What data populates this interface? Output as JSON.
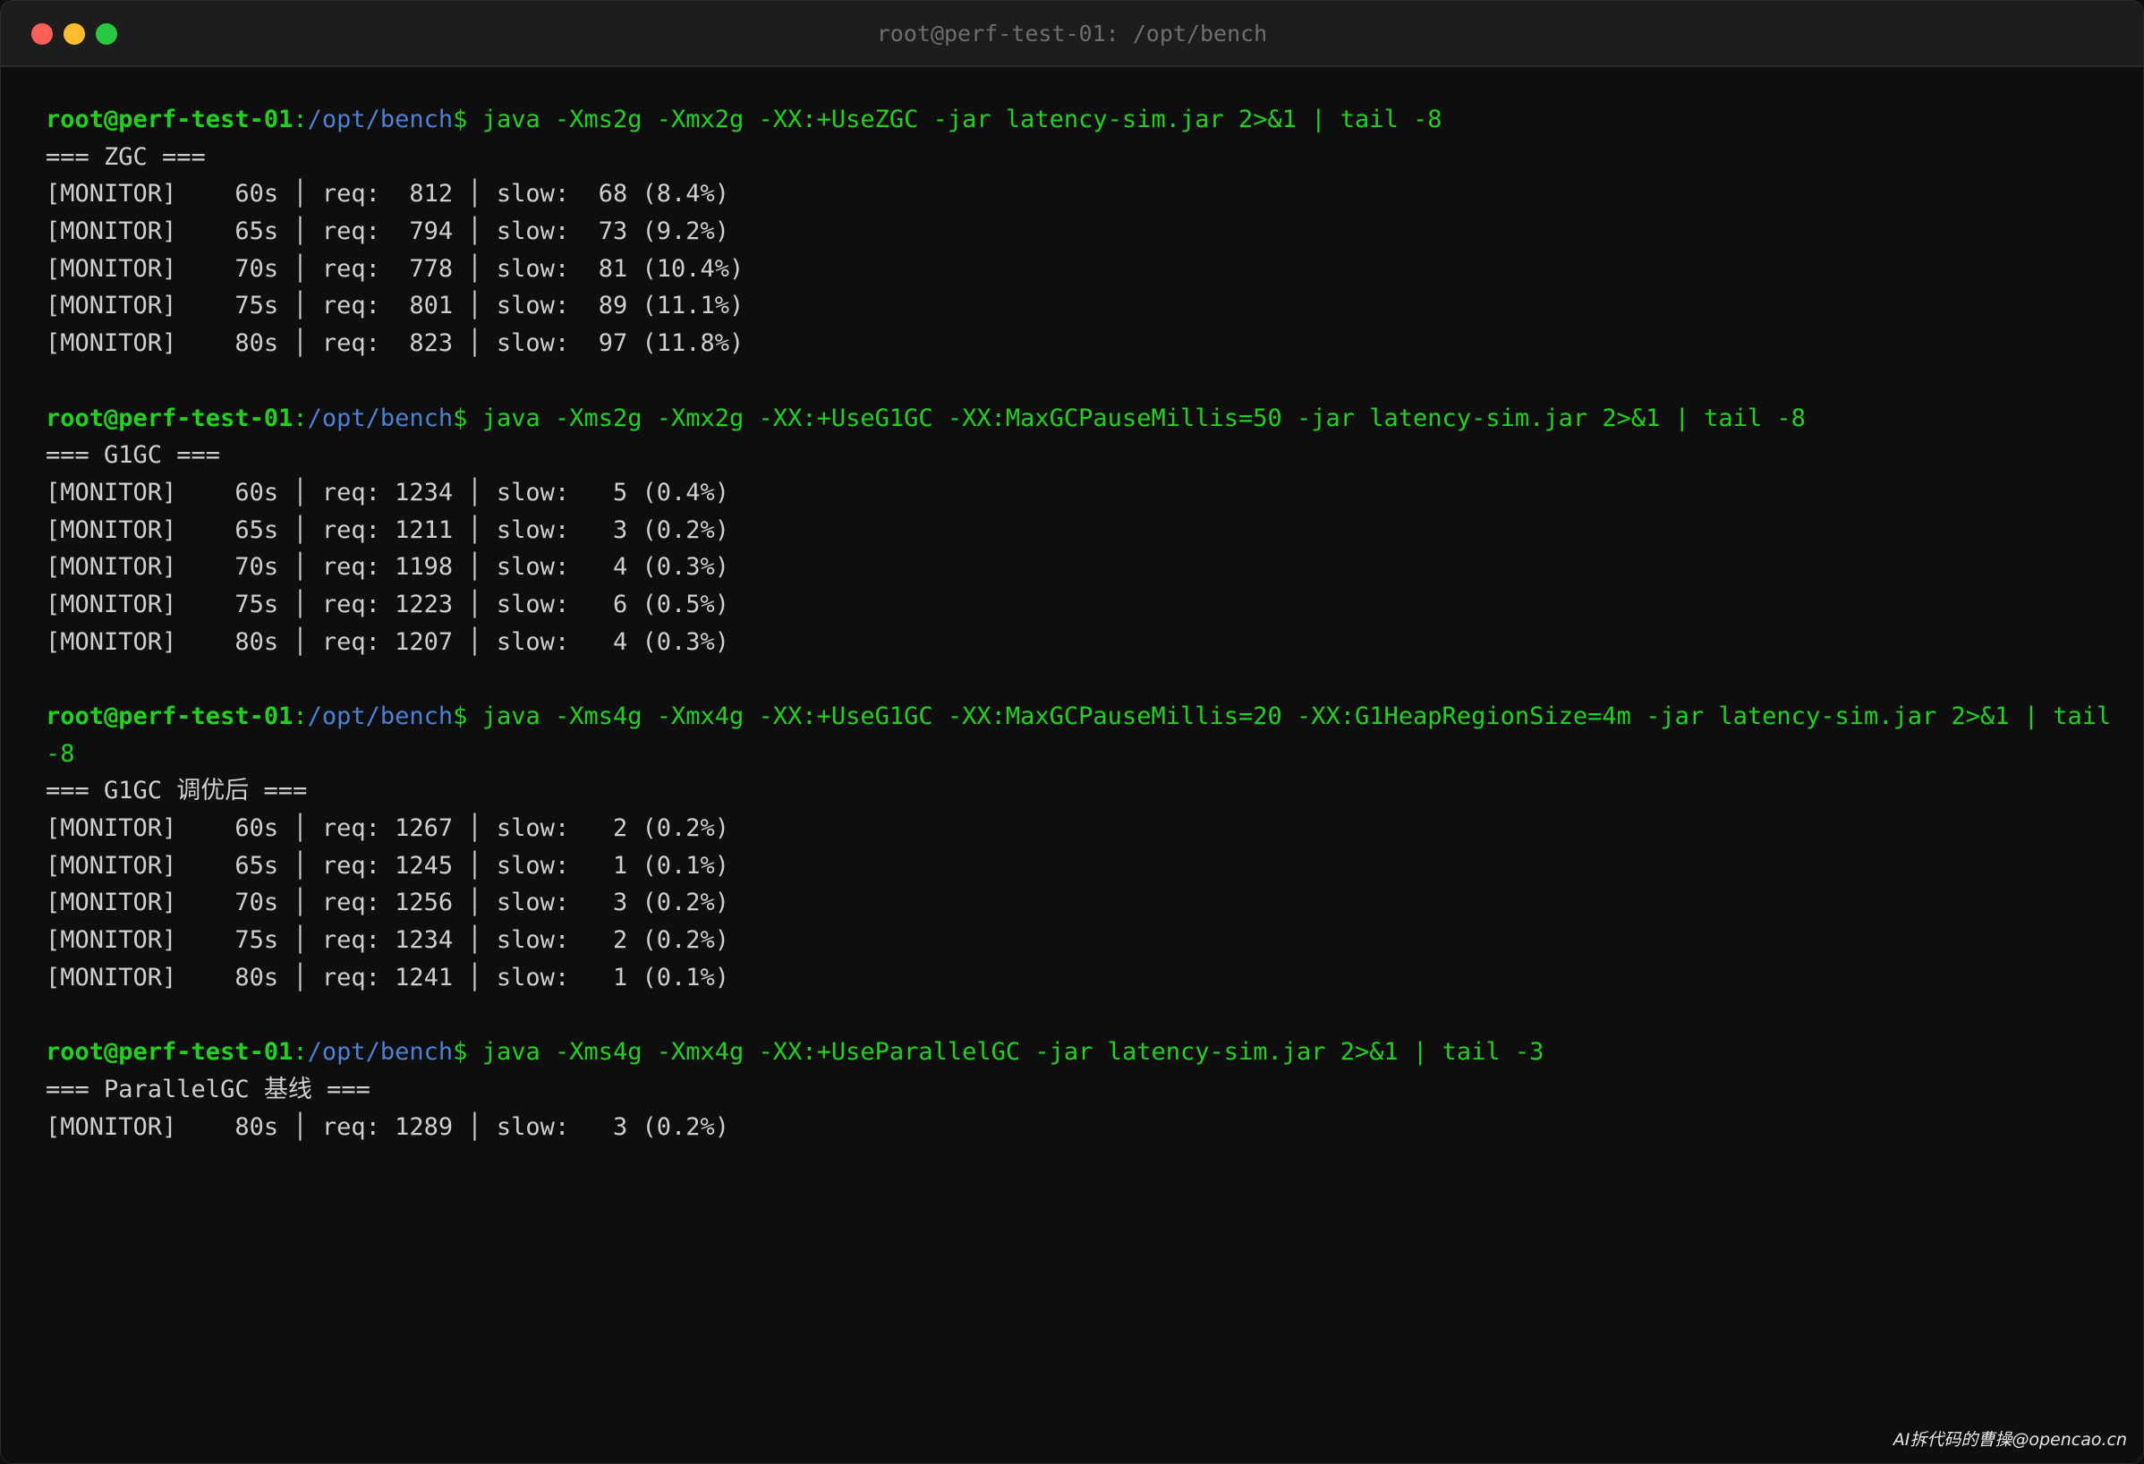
{
  "window": {
    "title": "root@perf-test-01: /opt/bench"
  },
  "prompt": {
    "user_host": "root@perf-test-01",
    "separator": ":",
    "path": "/opt/bench",
    "symbol": "$"
  },
  "blocks": [
    {
      "command": "java -Xms2g -Xmx2g -XX:+UseZGC -jar latency-sim.jar 2>&1 | tail -8",
      "command_cont": "",
      "header": "=== ZGC ===",
      "lines": [
        "[MONITOR]    60s │ req:  812 │ slow:  68 (8.4%)",
        "[MONITOR]    65s │ req:  794 │ slow:  73 (9.2%)",
        "[MONITOR]    70s │ req:  778 │ slow:  81 (10.4%)",
        "[MONITOR]    75s │ req:  801 │ slow:  89 (11.1%)",
        "[MONITOR]    80s │ req:  823 │ slow:  97 (11.8%)"
      ]
    },
    {
      "command": "java -Xms2g -Xmx2g -XX:+UseG1GC -XX:MaxGCPauseMillis=50 -jar latency-sim.jar 2>&1 | tail -8",
      "command_cont": "",
      "header": "=== G1GC ===",
      "lines": [
        "[MONITOR]    60s │ req: 1234 │ slow:   5 (0.4%)",
        "[MONITOR]    65s │ req: 1211 │ slow:   3 (0.2%)",
        "[MONITOR]    70s │ req: 1198 │ slow:   4 (0.3%)",
        "[MONITOR]    75s │ req: 1223 │ slow:   6 (0.5%)",
        "[MONITOR]    80s │ req: 1207 │ slow:   4 (0.3%)"
      ]
    },
    {
      "command": "java -Xms4g -Xmx4g -XX:+UseG1GC -XX:MaxGCPauseMillis=20 -XX:G1HeapRegionSize=4m -jar latency-sim.jar 2>&1 | tail",
      "command_cont": "-8",
      "header": "=== G1GC 调优后 ===",
      "lines": [
        "[MONITOR]    60s │ req: 1267 │ slow:   2 (0.2%)",
        "[MONITOR]    65s │ req: 1245 │ slow:   1 (0.1%)",
        "[MONITOR]    70s │ req: 1256 │ slow:   3 (0.2%)",
        "[MONITOR]    75s │ req: 1234 │ slow:   2 (0.2%)",
        "[MONITOR]    80s │ req: 1241 │ slow:   1 (0.1%)"
      ]
    },
    {
      "command": "java -Xms4g -Xmx4g -XX:+UseParallelGC -jar latency-sim.jar 2>&1 | tail -3",
      "command_cont": "",
      "header": "=== ParallelGC 基线 ===",
      "lines": [
        "[MONITOR]    80s │ req: 1289 │ slow:   3 (0.2%)"
      ]
    }
  ],
  "watermark": "AI拆代码的曹操@opencao.cn",
  "colors": {
    "prompt_green": "#21d11f",
    "path_blue": "#4b82d6",
    "output_text": "#cfcfcf",
    "background": "#0e0e0e"
  }
}
